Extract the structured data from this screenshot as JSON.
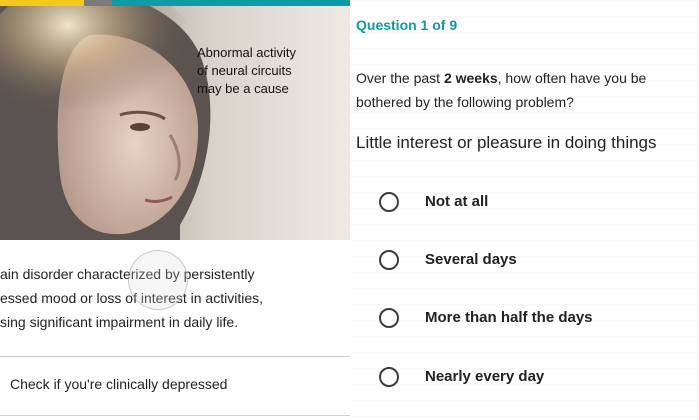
{
  "hero": {
    "caption_lines": [
      "Abnormal activity",
      "of neural circuits",
      "may be a cause"
    ],
    "progress_fraction": 0.24
  },
  "description": {
    "lines": [
      "ain disorder characterized by persistently",
      "essed mood or loss of interest in activities,",
      "sing significant impairment in daily life."
    ]
  },
  "link": {
    "label": "Check if you're clinically depressed"
  },
  "question": {
    "header": "Question 1 of 9",
    "prompt_prefix": "Over the past ",
    "prompt_bold": "2 weeks",
    "prompt_suffix": ", how often have you be",
    "prompt_line2": "bothered by the following problem?",
    "item": "Little interest or pleasure in doing things",
    "options": [
      "Not at all",
      "Several days",
      "More than half the days",
      "Nearly every day"
    ]
  },
  "colors": {
    "accent": "#0f9aa5",
    "progress": "#f2c91c"
  }
}
